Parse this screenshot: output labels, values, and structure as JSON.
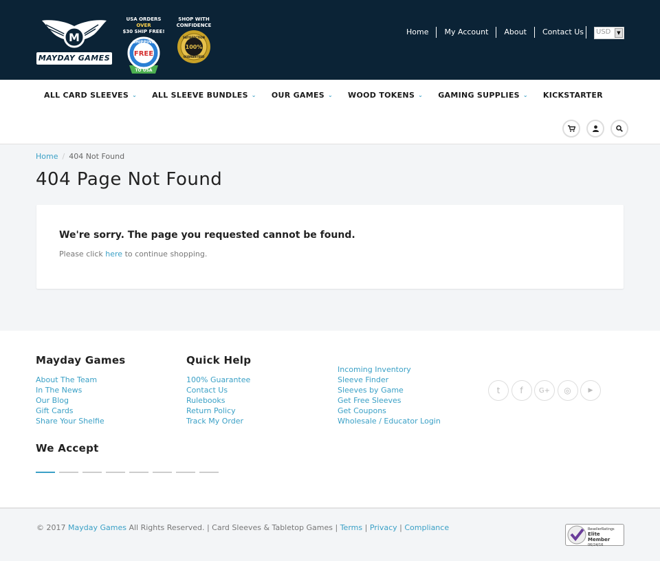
{
  "header": {
    "logo_text": "MAYDAY GAMES",
    "badge1": {
      "line1": "USA ORDERS",
      "accent": "OVER",
      "line2": "$30 SHIP FREE!",
      "seal_top": "SHIPPING",
      "seal_main": "FREE",
      "seal_bottom": "TO USA"
    },
    "badge2": {
      "line1": "SHOP WITH",
      "line2": "CONFIDENCE",
      "seal_top": "SATISFACTION",
      "seal_main": "100%",
      "seal_bottom": "GUARANTEED"
    },
    "links": [
      "Home",
      "My Account",
      "About",
      "Contact Us"
    ],
    "currency": "USD"
  },
  "nav": {
    "items": [
      {
        "label": "ALL CARD SLEEVES",
        "dropdown": true
      },
      {
        "label": "ALL SLEEVE BUNDLES",
        "dropdown": true
      },
      {
        "label": "OUR GAMES",
        "dropdown": true
      },
      {
        "label": "WOOD TOKENS",
        "dropdown": true
      },
      {
        "label": "GAMING SUPPLIES",
        "dropdown": true
      },
      {
        "label": "KICKSTARTER",
        "dropdown": false
      }
    ],
    "icons": [
      "cart-icon",
      "user-icon",
      "search-icon"
    ]
  },
  "breadcrumb": {
    "home": "Home",
    "sep": "/",
    "current": "404 Not Found"
  },
  "main": {
    "title": "404 Page Not Found",
    "heading": "We're sorry. The page you requested cannot be found.",
    "text_before": "Please click ",
    "link": "here",
    "text_after": " to continue shopping."
  },
  "footer": {
    "col1": {
      "title": "Mayday Games",
      "links": [
        "About The Team",
        "In The News",
        "Our Blog",
        "Gift Cards",
        "Share Your Shelfie"
      ]
    },
    "col2": {
      "title": "Quick Help",
      "links": [
        "100% Guarantee",
        "Contact Us",
        "Rulebooks",
        "Return Policy",
        "Track My Order"
      ]
    },
    "col3": {
      "links": [
        "Incoming Inventory",
        "Sleeve Finder",
        "Sleeves by Game",
        "Get Free Sleeves",
        "Get Coupons",
        "Wholesale / Educator Login"
      ]
    },
    "accept_title": "We Accept",
    "social": [
      {
        "icon": "twitter-icon",
        "glyph": "t"
      },
      {
        "icon": "facebook-icon",
        "glyph": "f"
      },
      {
        "icon": "google-plus-icon",
        "glyph": "G+"
      },
      {
        "icon": "instagram-icon",
        "glyph": "◎"
      },
      {
        "icon": "youtube-icon",
        "glyph": "▶"
      }
    ]
  },
  "bottom": {
    "prefix": "© 2017 ",
    "brand": "Mayday Games",
    "middle": " All Rights Reserved. | Card Sleeves & Tabletop Games | ",
    "terms": "Terms",
    "sep1": " | ",
    "privacy": "Privacy",
    "sep2": " | ",
    "compliance": "Compliance",
    "badge": {
      "line1": "ResellerRatings",
      "line2": "Elite Member",
      "line3": "06/24/16"
    }
  },
  "colors": {
    "header_bg": "#0b2336",
    "accent": "#3aa0c6"
  }
}
